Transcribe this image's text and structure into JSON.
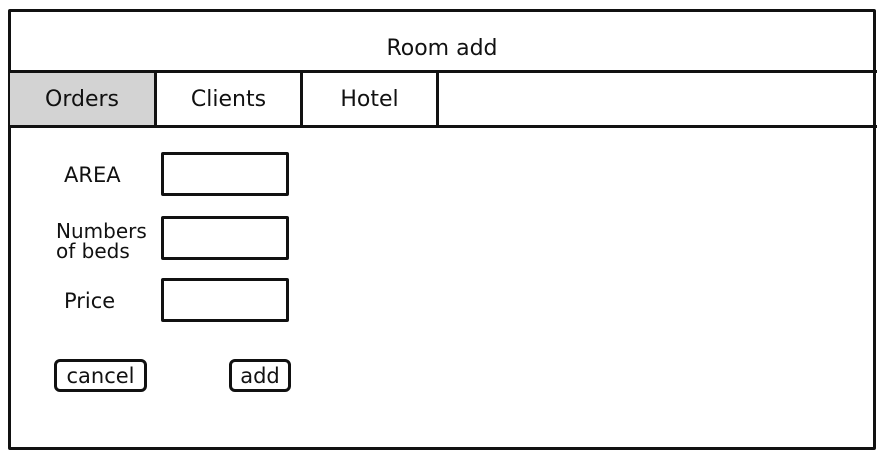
{
  "window": {
    "title": "Room add"
  },
  "tabs": [
    {
      "label": "Orders",
      "active": true
    },
    {
      "label": "Clients",
      "active": false
    },
    {
      "label": "Hotel",
      "active": false
    }
  ],
  "form": {
    "area": {
      "label": "AREA",
      "value": ""
    },
    "beds": {
      "label_line1": "Numbers",
      "label_line2": "of beds",
      "value": ""
    },
    "price": {
      "label": "Price",
      "value": ""
    }
  },
  "buttons": {
    "cancel_label": "cancel",
    "add_label": "add"
  },
  "colors": {
    "active_tab": "#d3d3d3",
    "stroke": "#111111",
    "background": "#ffffff"
  }
}
